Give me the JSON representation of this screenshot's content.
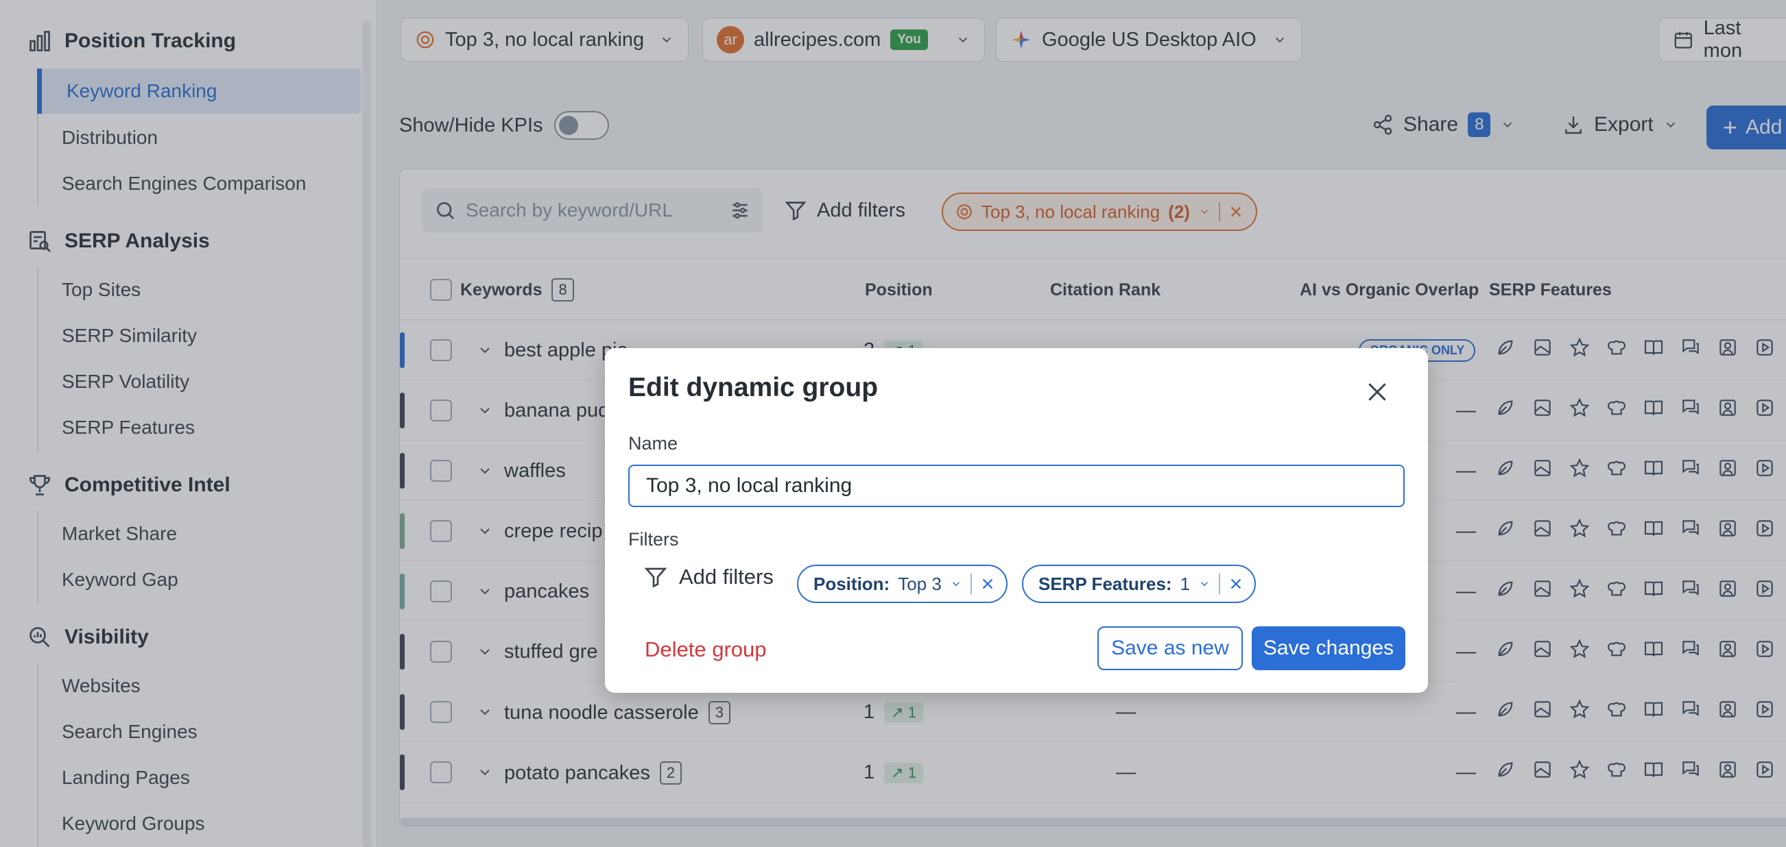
{
  "sidebar": {
    "sections": [
      {
        "title": "Position Tracking",
        "icon": "bar-chart-icon",
        "items": [
          "Keyword Ranking",
          "Distribution",
          "Search Engines Comparison"
        ]
      },
      {
        "title": "SERP Analysis",
        "icon": "serp-analysis-icon",
        "items": [
          "Top Sites",
          "SERP Similarity",
          "SERP Volatility",
          "SERP Features"
        ]
      },
      {
        "title": "Competitive Intel",
        "icon": "trophy-icon",
        "items": [
          "Market Share",
          "Keyword Gap"
        ]
      },
      {
        "title": "Visibility",
        "icon": "visibility-search-icon",
        "items": [
          "Websites",
          "Search Engines",
          "Landing Pages",
          "Keyword Groups"
        ]
      }
    ],
    "active_item": "Keyword Ranking"
  },
  "topbar": {
    "group_select": "Top 3, no local ranking",
    "domain_avatar": "ar",
    "domain": "allrecipes.com",
    "domain_badge": "You",
    "engine": "Google US Desktop AIO",
    "date": "Last mon"
  },
  "toolbar": {
    "kpi_label": "Show/Hide KPIs",
    "share_label": "Share",
    "share_count": "8",
    "export_label": "Export",
    "add_label": "Add"
  },
  "filters_bar": {
    "search_placeholder": "Search by keyword/URL",
    "add_filters": "Add filters",
    "active_chip": "Top 3, no local ranking",
    "active_chip_count": "(2)"
  },
  "table": {
    "headers": {
      "keywords": "Keywords",
      "keywords_count": "8",
      "position": "Position",
      "citation": "Citation Rank",
      "overlap": "AI vs Organic Overlap",
      "serp": "SERP Features"
    },
    "rows": [
      {
        "keyword": "best apple pie",
        "count": "",
        "position": "2",
        "change": "1",
        "citation": "",
        "overlap": "ORGANIC ONLY",
        "color": "#2b6ed6"
      },
      {
        "keyword": "banana pud",
        "count": "",
        "position": "",
        "change": "",
        "citation": "",
        "overlap": "—",
        "color": "#3d4450"
      },
      {
        "keyword": "waffles",
        "count": "",
        "position": "",
        "change": "",
        "citation": "",
        "overlap": "—",
        "color": "#3d4450"
      },
      {
        "keyword": "crepe recip",
        "count": "",
        "position": "",
        "change": "",
        "citation": "",
        "overlap": "—",
        "color": "#7fa894"
      },
      {
        "keyword": "pancakes",
        "count": "",
        "position": "",
        "change": "",
        "citation": "",
        "overlap": "—",
        "color": "#7fa8a4"
      },
      {
        "keyword": "stuffed gre",
        "count": "",
        "position": "",
        "change": "",
        "citation": "",
        "overlap": "—",
        "color": "#3d4450"
      },
      {
        "keyword": "tuna noodle casserole",
        "count": "3",
        "position": "1",
        "change": "1",
        "citation": "—",
        "overlap": "—",
        "color": "#3d4450"
      },
      {
        "keyword": "potato pancakes",
        "count": "2",
        "position": "1",
        "change": "1",
        "citation": "—",
        "overlap": "—",
        "color": "#3d4450"
      }
    ]
  },
  "modal": {
    "title": "Edit dynamic group",
    "name_label": "Name",
    "name_value": "Top 3, no local ranking",
    "filters_label": "Filters",
    "add_filters": "Add filters",
    "chips": [
      {
        "key": "Position:",
        "value": "Top 3"
      },
      {
        "key": "SERP Features:",
        "value": "1"
      }
    ],
    "delete_label": "Delete group",
    "save_new_label": "Save as new",
    "save_label": "Save changes"
  },
  "colors": {
    "accent": "#2b6ed6",
    "danger": "#d4383c",
    "warning": "#e07030"
  }
}
